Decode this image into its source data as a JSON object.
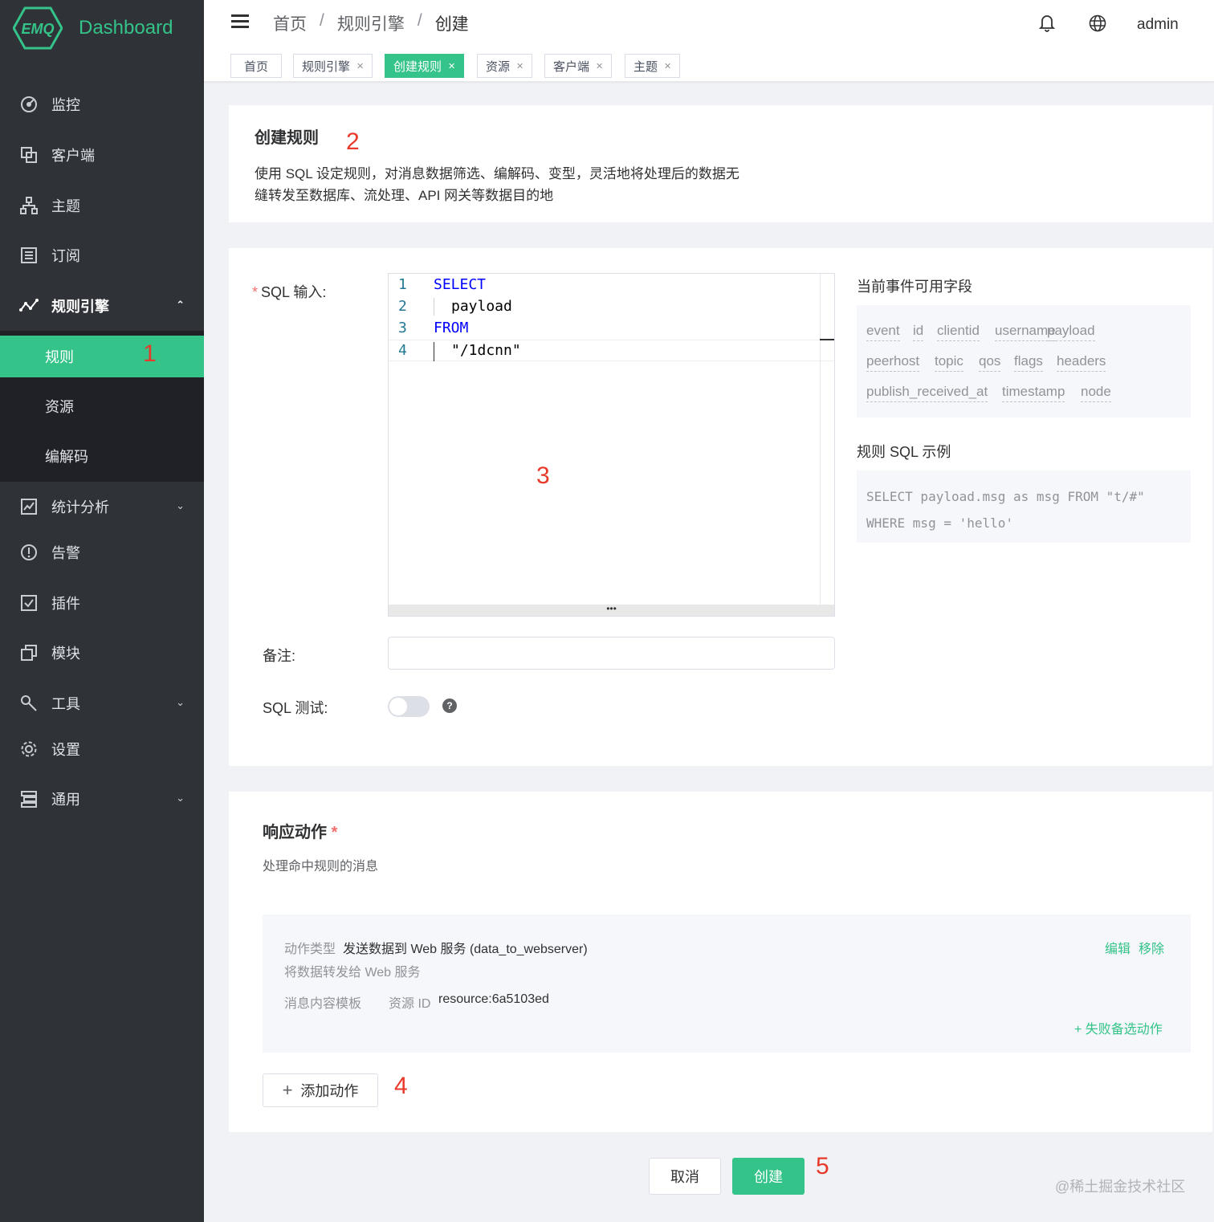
{
  "app": {
    "logo_text": "Dashboard",
    "logo_badge": "EMQ"
  },
  "sidebar": {
    "items": [
      {
        "label": "监控",
        "icon": "monitor-icon"
      },
      {
        "label": "客户端",
        "icon": "clients-icon"
      },
      {
        "label": "主题",
        "icon": "topics-icon"
      },
      {
        "label": "订阅",
        "icon": "subscriptions-icon"
      },
      {
        "label": "规则引擎",
        "icon": "rule-engine-icon"
      },
      {
        "label": "统计分析",
        "icon": "analysis-icon"
      },
      {
        "label": "告警",
        "icon": "alarm-icon"
      },
      {
        "label": "插件",
        "icon": "plugins-icon"
      },
      {
        "label": "模块",
        "icon": "modules-icon"
      },
      {
        "label": "工具",
        "icon": "tools-icon"
      },
      {
        "label": "设置",
        "icon": "settings-icon"
      },
      {
        "label": "通用",
        "icon": "general-icon"
      }
    ],
    "sub_items": [
      "规则",
      "资源",
      "编解码"
    ],
    "active_sub": "规则"
  },
  "header": {
    "breadcrumb": [
      "首页",
      "规则引擎",
      "创建"
    ],
    "separator": "/",
    "user": "admin"
  },
  "tags": [
    {
      "label": "首页",
      "closable": false,
      "active": false
    },
    {
      "label": "规则引擎",
      "closable": true,
      "active": false
    },
    {
      "label": "创建规则",
      "closable": true,
      "active": true
    },
    {
      "label": "资源",
      "closable": true,
      "active": false
    },
    {
      "label": "客户端",
      "closable": true,
      "active": false
    },
    {
      "label": "主题",
      "closable": true,
      "active": false
    }
  ],
  "intro": {
    "title": "创建规则",
    "desc_line1": "使用 SQL 设定规则，对消息数据筛选、编解码、变型，灵活地将处理后的数据无",
    "desc_line2": "缝转发至数据库、流处理、API 网关等数据目的地"
  },
  "form": {
    "sql_label": "SQL 输入:",
    "sql_lines": [
      {
        "n": "1",
        "text": "SELECT",
        "kind": "kw"
      },
      {
        "n": "2",
        "text": "payload",
        "kind": "txt"
      },
      {
        "n": "3",
        "text": "FROM",
        "kind": "kw"
      },
      {
        "n": "4",
        "text": "\"/1dcnn\"",
        "kind": "txt"
      }
    ],
    "editor_resize": "•••",
    "note_label": "备注:",
    "note_value": "",
    "sql_test_label": "SQL 测试:",
    "sql_test_enabled": false,
    "help": "?"
  },
  "fields_panel": {
    "title": "当前事件可用字段",
    "fields": [
      "event",
      "id",
      "clientid",
      "username",
      "payload",
      "peerhost",
      "topic",
      "qos",
      "flags",
      "headers",
      "publish_received_at",
      "timestamp",
      "node"
    ],
    "example_title": "规则 SQL 示例",
    "example_line1": "SELECT payload.msg as msg FROM \"t/#\"",
    "example_line2": "WHERE msg = 'hello'"
  },
  "actions": {
    "title": "响应动作",
    "required_mark": "*",
    "desc": "处理命中规则的消息",
    "item": {
      "type_label": "动作类型",
      "type_value": "发送数据到 Web 服务 (data_to_webserver)",
      "sub_desc": "将数据转发给 Web 服务",
      "template_label": "消息内容模板",
      "resource_label": "资源 ID",
      "resource_value": "resource:6a5103ed",
      "edit": "编辑",
      "remove": "移除",
      "fallback": "+ 失败备选动作"
    },
    "add_button": "添加动作"
  },
  "footer": {
    "cancel": "取消",
    "create": "创建"
  },
  "annotations": [
    "1",
    "2",
    "3",
    "4",
    "5"
  ],
  "watermark": "@稀土掘金技术社区",
  "colors": {
    "accent": "#34c388",
    "sidebar": "#2f3237",
    "annotation": "#e8392b"
  }
}
